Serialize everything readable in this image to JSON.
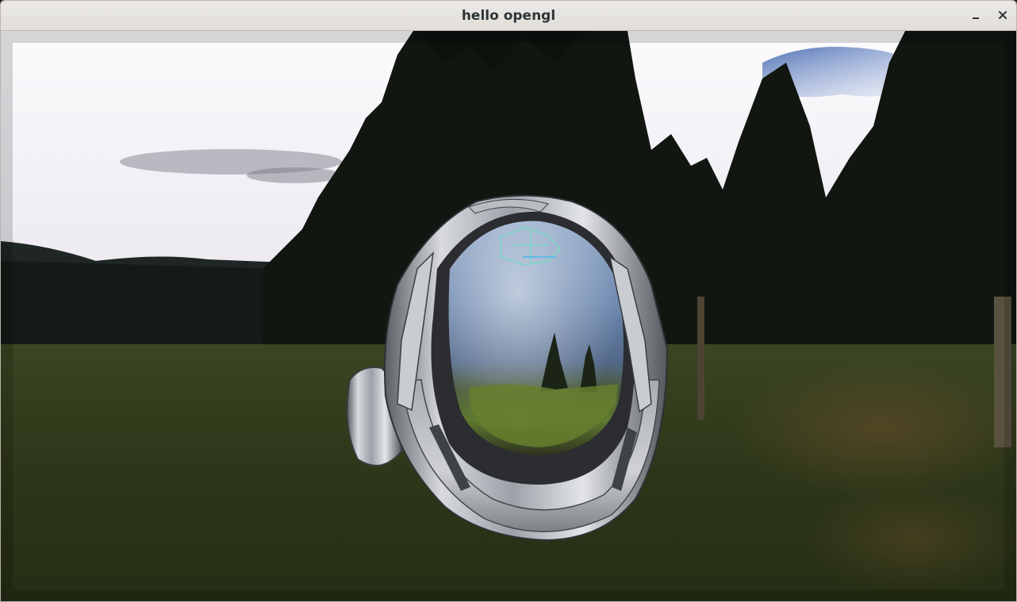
{
  "window": {
    "title": "hello opengl",
    "controls": [
      "minimize-icon",
      "close-icon"
    ]
  },
  "scene": {
    "environment": "skybox-meadow-forest",
    "object": "metallic-helmet",
    "colors": {
      "titlebar": "#e6e3df",
      "title_text": "#2e3436",
      "sky": "#f4f2f6",
      "sky_blue": "#5a7fbf",
      "trees": "#141a14",
      "grass": "#2f3a1c"
    }
  }
}
